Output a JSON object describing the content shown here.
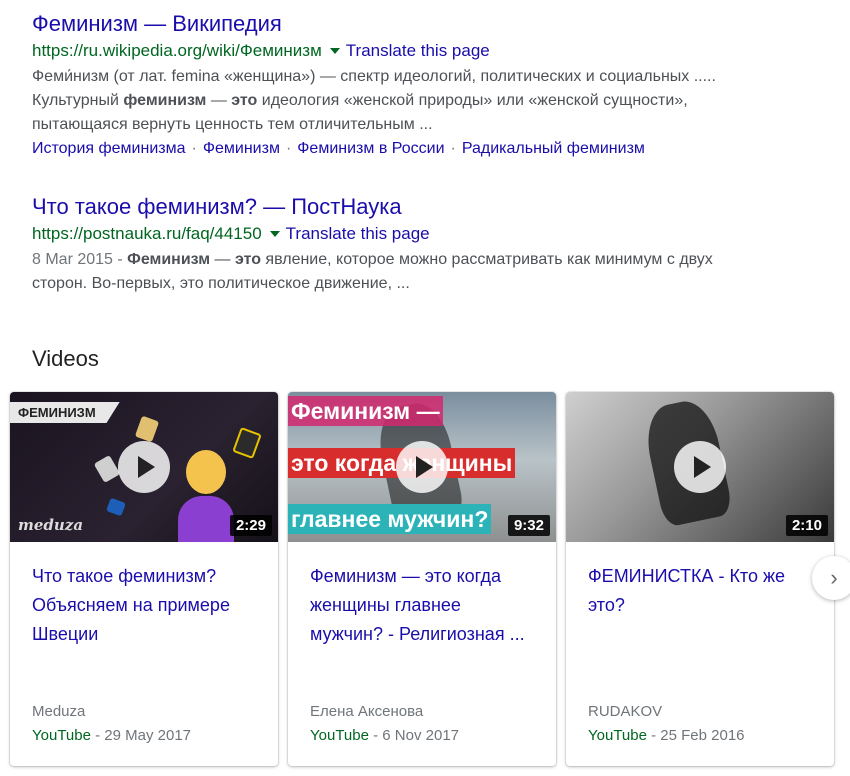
{
  "results": [
    {
      "title": "Феминизм — Википедия",
      "url": "https://ru.wikipedia.org/wiki/Феминизм",
      "translate": "Translate this page",
      "snippet_line1": "Феми́низм (от лат. femina «женщина») — спектр идеологий, политических и социальных .....",
      "snippet_l2_pre": "Культурный ",
      "snippet_l2_bold1": "феминизм",
      "snippet_l2_mid": " — ",
      "snippet_l2_bold2": "это",
      "snippet_l2_post": " идеология «женской природы» или «женской сущности»,",
      "snippet_line3": "пытающаяся вернуть ценность тем отличительным ...",
      "sitelinks": [
        "История феминизма",
        "Феминизм",
        "Феминизм в России",
        "Радикальный феминизм"
      ]
    },
    {
      "title": "Что такое феминизм? — ПостНаука",
      "url": "https://postnauka.ru/faq/44150",
      "translate": "Translate this page",
      "date": "8 Mar 2015 - ",
      "snippet_bold1": "Феминизм",
      "snippet_mid": " — ",
      "snippet_bold2": "это",
      "snippet_l1_post": " явление, которое можно рассматривать как минимум с двух",
      "snippet_line2": "сторон. Во-первых, это политическое движение, ..."
    }
  ],
  "videos": {
    "heading": "Videos",
    "items": [
      {
        "title": "Что такое феминизм? Объясняем на примере Швеции",
        "duration": "2:29",
        "badge": "ФЕМИНИЗМ",
        "watermark": "meduza",
        "channel": "Meduza",
        "source": "YouTube",
        "date": " - 29 May 2017"
      },
      {
        "title": "Феминизм — это когда женщины главнее мужчин? - Религиозная ...",
        "duration": "9:32",
        "overlay": [
          "Феминизм —",
          "это когда женщины",
          "главнее мужчин?"
        ],
        "channel": "Елена Аксенова",
        "source": "YouTube",
        "date": " - 6 Nov 2017"
      },
      {
        "title": "ФЕМИНИСТКА - Кто же это?",
        "duration": "2:10",
        "channel": "RUDAKOV",
        "source": "YouTube",
        "date": " - 25 Feb 2016"
      }
    ],
    "next_icon": "chevron-right-icon"
  }
}
